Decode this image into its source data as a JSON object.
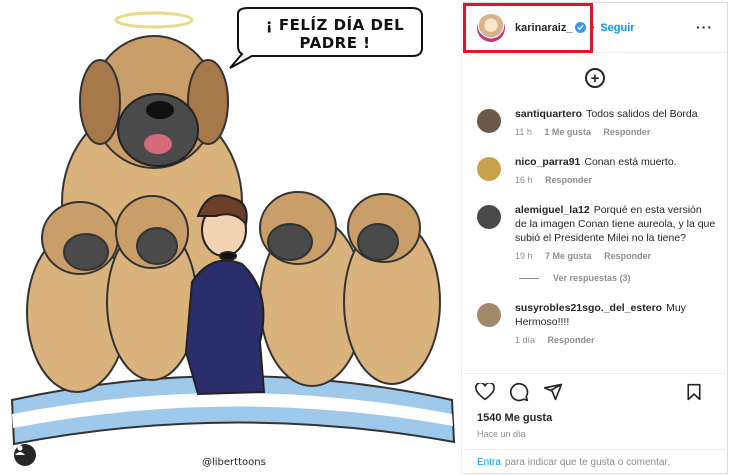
{
  "post": {
    "speech_text": "¡ FELÍZ DÍA DEL PADRE !",
    "credit": "@liberttoons"
  },
  "header": {
    "username": "karinaraiz_",
    "separator": "•",
    "follow_label": "Seguir",
    "more_icon": "more-horizontal-icon"
  },
  "comments": [
    {
      "user": "santiquartero",
      "text": "Todos salidos del Borda",
      "time": "11 h",
      "likes": "1 Me gusta",
      "reply": "Responder",
      "avatar_color": "#6b5a4a"
    },
    {
      "user": "nico_parra91",
      "text": "Conan está muerto.",
      "time": "16 h",
      "likes": "",
      "reply": "Responder",
      "avatar_color": "#c8a24a"
    },
    {
      "user": "alemiguel_la12",
      "text": "Porqué en esta versión de la imagen Conan tiene aureola, y la que subió el Presidente Milei no la tiene?",
      "time": "19 h",
      "likes": "7 Me gusta",
      "reply": "Responder",
      "avatar_color": "#4a4a4a"
    },
    {
      "user": "susyrobles21sgo._del_estero",
      "text": "Muy Hermoso!!!!",
      "time": "1 día",
      "likes": "",
      "reply": "Responder",
      "avatar_color": "#a08a6a"
    }
  ],
  "replies_label": "Ver respuestas (3)",
  "likes_count": "1540 Me gusta",
  "time_ago": "Hace un día",
  "add_comment": {
    "enter_label": "Entra",
    "rest": "para indicar que te gusta o comentar."
  },
  "colors": {
    "accent": "#0095f6",
    "highlight_box": "#e1142a",
    "dog_fur": "#d9b27c",
    "suit": "#2a2f6b"
  }
}
